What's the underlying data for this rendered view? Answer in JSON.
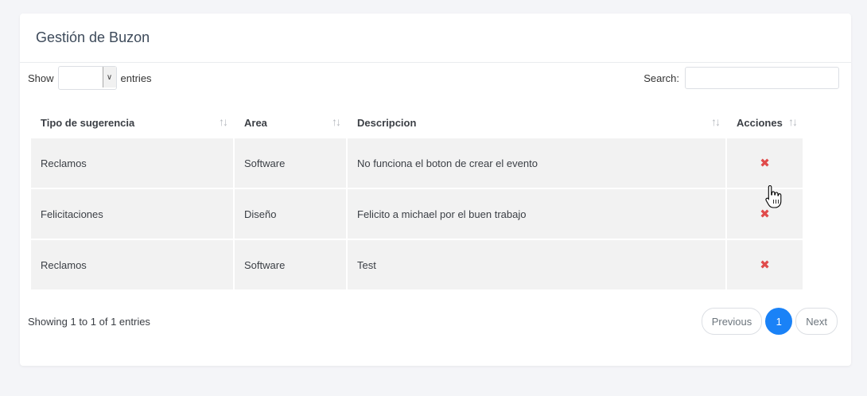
{
  "card": {
    "title": "Gestión de Buzon"
  },
  "length": {
    "prefix": "Show",
    "suffix": "entries",
    "value": ""
  },
  "search": {
    "label": "Search:",
    "value": ""
  },
  "table": {
    "columns": [
      "Tipo de sugerencia",
      "Area",
      "Descripcion",
      "Acciones"
    ],
    "rows": [
      {
        "tipo": "Reclamos",
        "area": "Software",
        "descripcion": "No funciona el boton de crear el evento",
        "accion": "✖"
      },
      {
        "tipo": "Felicitaciones",
        "area": "Diseño",
        "descripcion": "Felicito a michael por el buen trabajo",
        "accion": "✖"
      },
      {
        "tipo": "Reclamos",
        "area": "Software",
        "descripcion": "Test",
        "accion": "✖"
      }
    ]
  },
  "footer": {
    "info": "Showing 1 to 1 of 1 entries",
    "previous": "Previous",
    "page": "1",
    "next": "Next"
  },
  "colors": {
    "accent": "#1a82f7",
    "delete": "#e04b4b",
    "row_bg": "#f2f2f2"
  },
  "icons": {
    "sort": "sort-arrows-icon",
    "delete": "close-icon",
    "cursor": "hand-pointer-icon"
  }
}
